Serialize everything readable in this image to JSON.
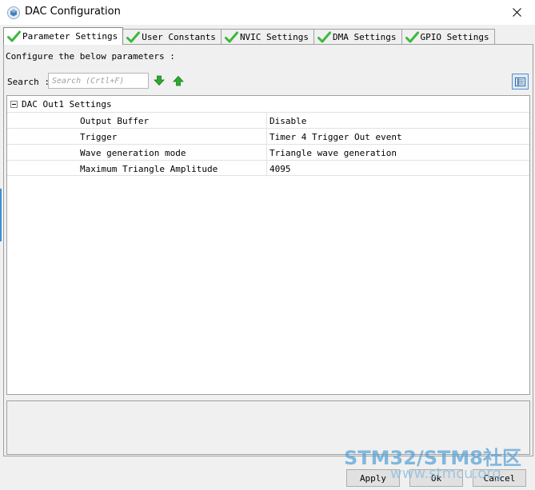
{
  "window": {
    "title": "DAC Configuration"
  },
  "tabs": [
    {
      "label": "Parameter Settings",
      "active": true
    },
    {
      "label": "User Constants",
      "active": false
    },
    {
      "label": "NVIC Settings",
      "active": false
    },
    {
      "label": "DMA Settings",
      "active": false
    },
    {
      "label": "GPIO Settings",
      "active": false
    }
  ],
  "panel": {
    "configure_label": "Configure the below parameters :",
    "search_label": "Search :",
    "search_placeholder": "Search (Crtl+F)"
  },
  "tree": {
    "group_label": "DAC Out1 Settings",
    "rows": [
      {
        "name": "Output Buffer",
        "value": "Disable"
      },
      {
        "name": "Trigger",
        "value": "Timer 4 Trigger Out event"
      },
      {
        "name": "Wave generation mode",
        "value": "Triangle wave generation"
      },
      {
        "name": "Maximum Triangle Amplitude",
        "value": "4095"
      }
    ]
  },
  "buttons": {
    "apply": "Apply",
    "ok": "Ok",
    "cancel": "Cancel"
  },
  "watermark": {
    "main": "STM32/STM8社区",
    "sub": "www.stmcu.org"
  },
  "colors": {
    "accent": "#3c8fd8",
    "check_green": "#3cb83c",
    "arrow_green": "#2fa82f"
  }
}
